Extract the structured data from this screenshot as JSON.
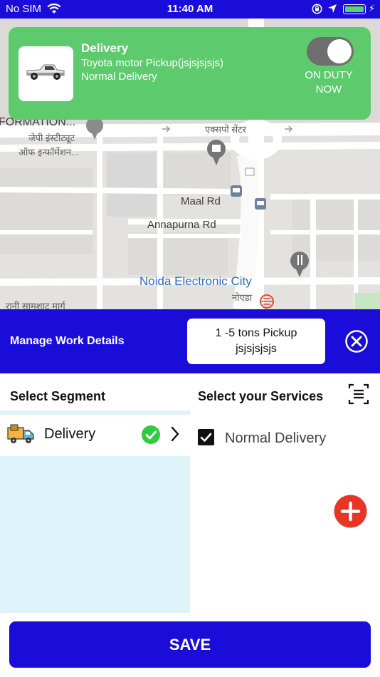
{
  "status_bar": {
    "carrier": "No SIM",
    "time": "11:40 AM"
  },
  "map": {
    "labels": {
      "information": "FORMATION...",
      "jaypee_hindi_1": "जेपी इंस्टीट्यूट",
      "jaypee_hindi_2": "ऑफ इन्फॉर्मेशन...",
      "expo_hindi": "एक्सपो सेंटर",
      "maal_rd": "Maal Rd",
      "annapurna_rd": "Annapurna Rd",
      "noida_electronic_city": "Noida Electronic City",
      "noida_hindi": "नोएडा",
      "rani_hindi": "रानी सामशाट मार्ग"
    }
  },
  "delivery_card": {
    "title": "Delivery",
    "vehicle": "Toyota motor Pickup(jsjsjsjsjs)",
    "service": "Normal Delivery",
    "duty_status_line1": "ON DUTY",
    "duty_status_line2": "NOW",
    "toggle_on": true
  },
  "manage_bar": {
    "title": "Manage Work Details",
    "vehicle_chip_line1": "1 -5 tons Pickup",
    "vehicle_chip_line2": "jsjsjsjsjs"
  },
  "segments": {
    "header": "Select Segment",
    "items": [
      {
        "label": "Delivery",
        "selected": true
      }
    ]
  },
  "services": {
    "header": "Select your Services",
    "items": [
      {
        "label": "Normal Delivery",
        "checked": true
      }
    ]
  },
  "save_label": "SAVE",
  "colors": {
    "primary_blue": "#1a0dd9",
    "card_green": "#5dcb6d",
    "check_green": "#2ecc40",
    "add_red": "#e53626",
    "segment_bg": "#dff3fb"
  },
  "icons": {
    "wifi": "wifi-icon",
    "lock": "orientation-lock-icon",
    "location": "location-arrow-icon",
    "battery": "battery-icon",
    "vehicle": "pickup-truck-icon",
    "close": "close-circle-icon",
    "segment_vehicle": "delivery-truck-icon",
    "selected": "check-circle-icon",
    "chevron": "chevron-right-icon",
    "list": "list-icon",
    "checkbox": "checkbox-checked-icon",
    "add": "add-circle-icon"
  }
}
